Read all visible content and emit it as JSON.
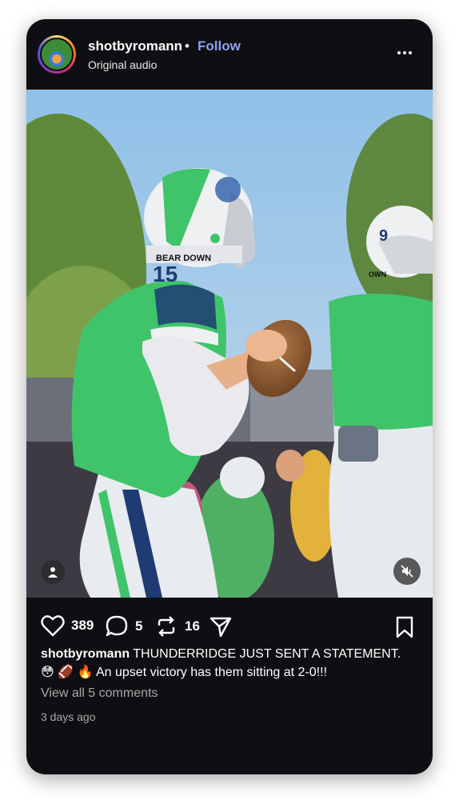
{
  "header": {
    "username": "shotbyromann",
    "separator": "•",
    "follow_label": "Follow",
    "audio_label": "Original audio",
    "more_icon": "more-horizontal-icon"
  },
  "photo": {
    "description_icons": [
      "user-tag-icon",
      "mute-icon"
    ],
    "helmet_text_1": "15",
    "helmet_text_2": "BEAR DOWN",
    "helmet_text_3": "9",
    "helmet_text_4": "OWN"
  },
  "actions": {
    "like_icon": "heart-icon",
    "like_count": "389",
    "comment_icon": "comment-icon",
    "comment_count": "5",
    "repost_icon": "repost-icon",
    "repost_count": "16",
    "share_icon": "send-icon",
    "save_icon": "bookmark-icon"
  },
  "caption": {
    "username": "shotbyromann",
    "text": "THUNDERRIDGE JUST SENT A STATEMENT. 😳 🏈 🔥 An upset victory has them sitting at 2-0!!!"
  },
  "view_comments": "View all 5 comments",
  "timestamp": "3 days ago",
  "colors": {
    "card_bg": "#0e0f12",
    "follow_blue": "#8ea2f0",
    "muted_text": "#a8a8a8",
    "jersey_green": "#3fc46a"
  }
}
